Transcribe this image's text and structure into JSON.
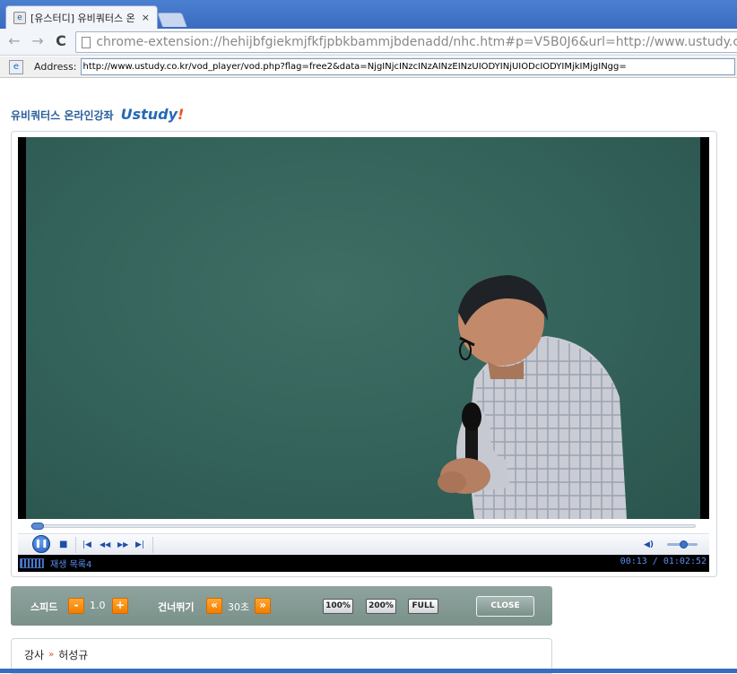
{
  "browser": {
    "tab_title": "[유스터디] 유비쿼터스 온",
    "tab_close": "×",
    "favicon_glyph": "e",
    "omnibox_url": "chrome-extension://hehijbfgiekmjfkfjpbkbammjbdenadd/nhc.htm#p=V5B0J6&url=http://www.ustudy.co.kr/vod_",
    "nav": {
      "back": "←",
      "forward": "→",
      "reload": "C"
    }
  },
  "ie_bar": {
    "address_label": "Address:",
    "address_value": "http://www.ustudy.co.kr/vod_player/vod.php?flag=free2&data=NjgINjcINzcINzAINzEINzUIODYINjUIODcIODYIMjkIMjgINgg="
  },
  "brand": {
    "text": "유비쿼터스 온라인강좌",
    "logo_main": "Ustudy",
    "logo_bang": "!"
  },
  "player": {
    "seek_progress": 0.009,
    "volume_level": 0.55,
    "status_label": "재생 목록4",
    "time": "00:13 / 01:02:52",
    "icons": {
      "play_pause": "❚❚",
      "stop": "■",
      "prev": "|◀",
      "rewind": "◀◀",
      "forward": "▶▶",
      "next": "▶|",
      "volume": "◀)"
    }
  },
  "panel": {
    "speed_label": "스피드",
    "speed_minus": "-",
    "speed_value": "1.0",
    "speed_plus": "+",
    "skip_label": "건너뛰기",
    "skip_back": "«",
    "skip_value": "30초",
    "skip_forward": "»",
    "zoom_100": "100%",
    "zoom_200": "200%",
    "zoom_full": "FULL",
    "close": "CLOSE"
  },
  "info": {
    "label": "강사",
    "arrow": "»",
    "name": "허성규"
  },
  "colors": {
    "board": "#33625a",
    "brand_blue": "#2469b5",
    "accent_orange": "#f07d00",
    "panel_gray": "#8ea39d"
  }
}
